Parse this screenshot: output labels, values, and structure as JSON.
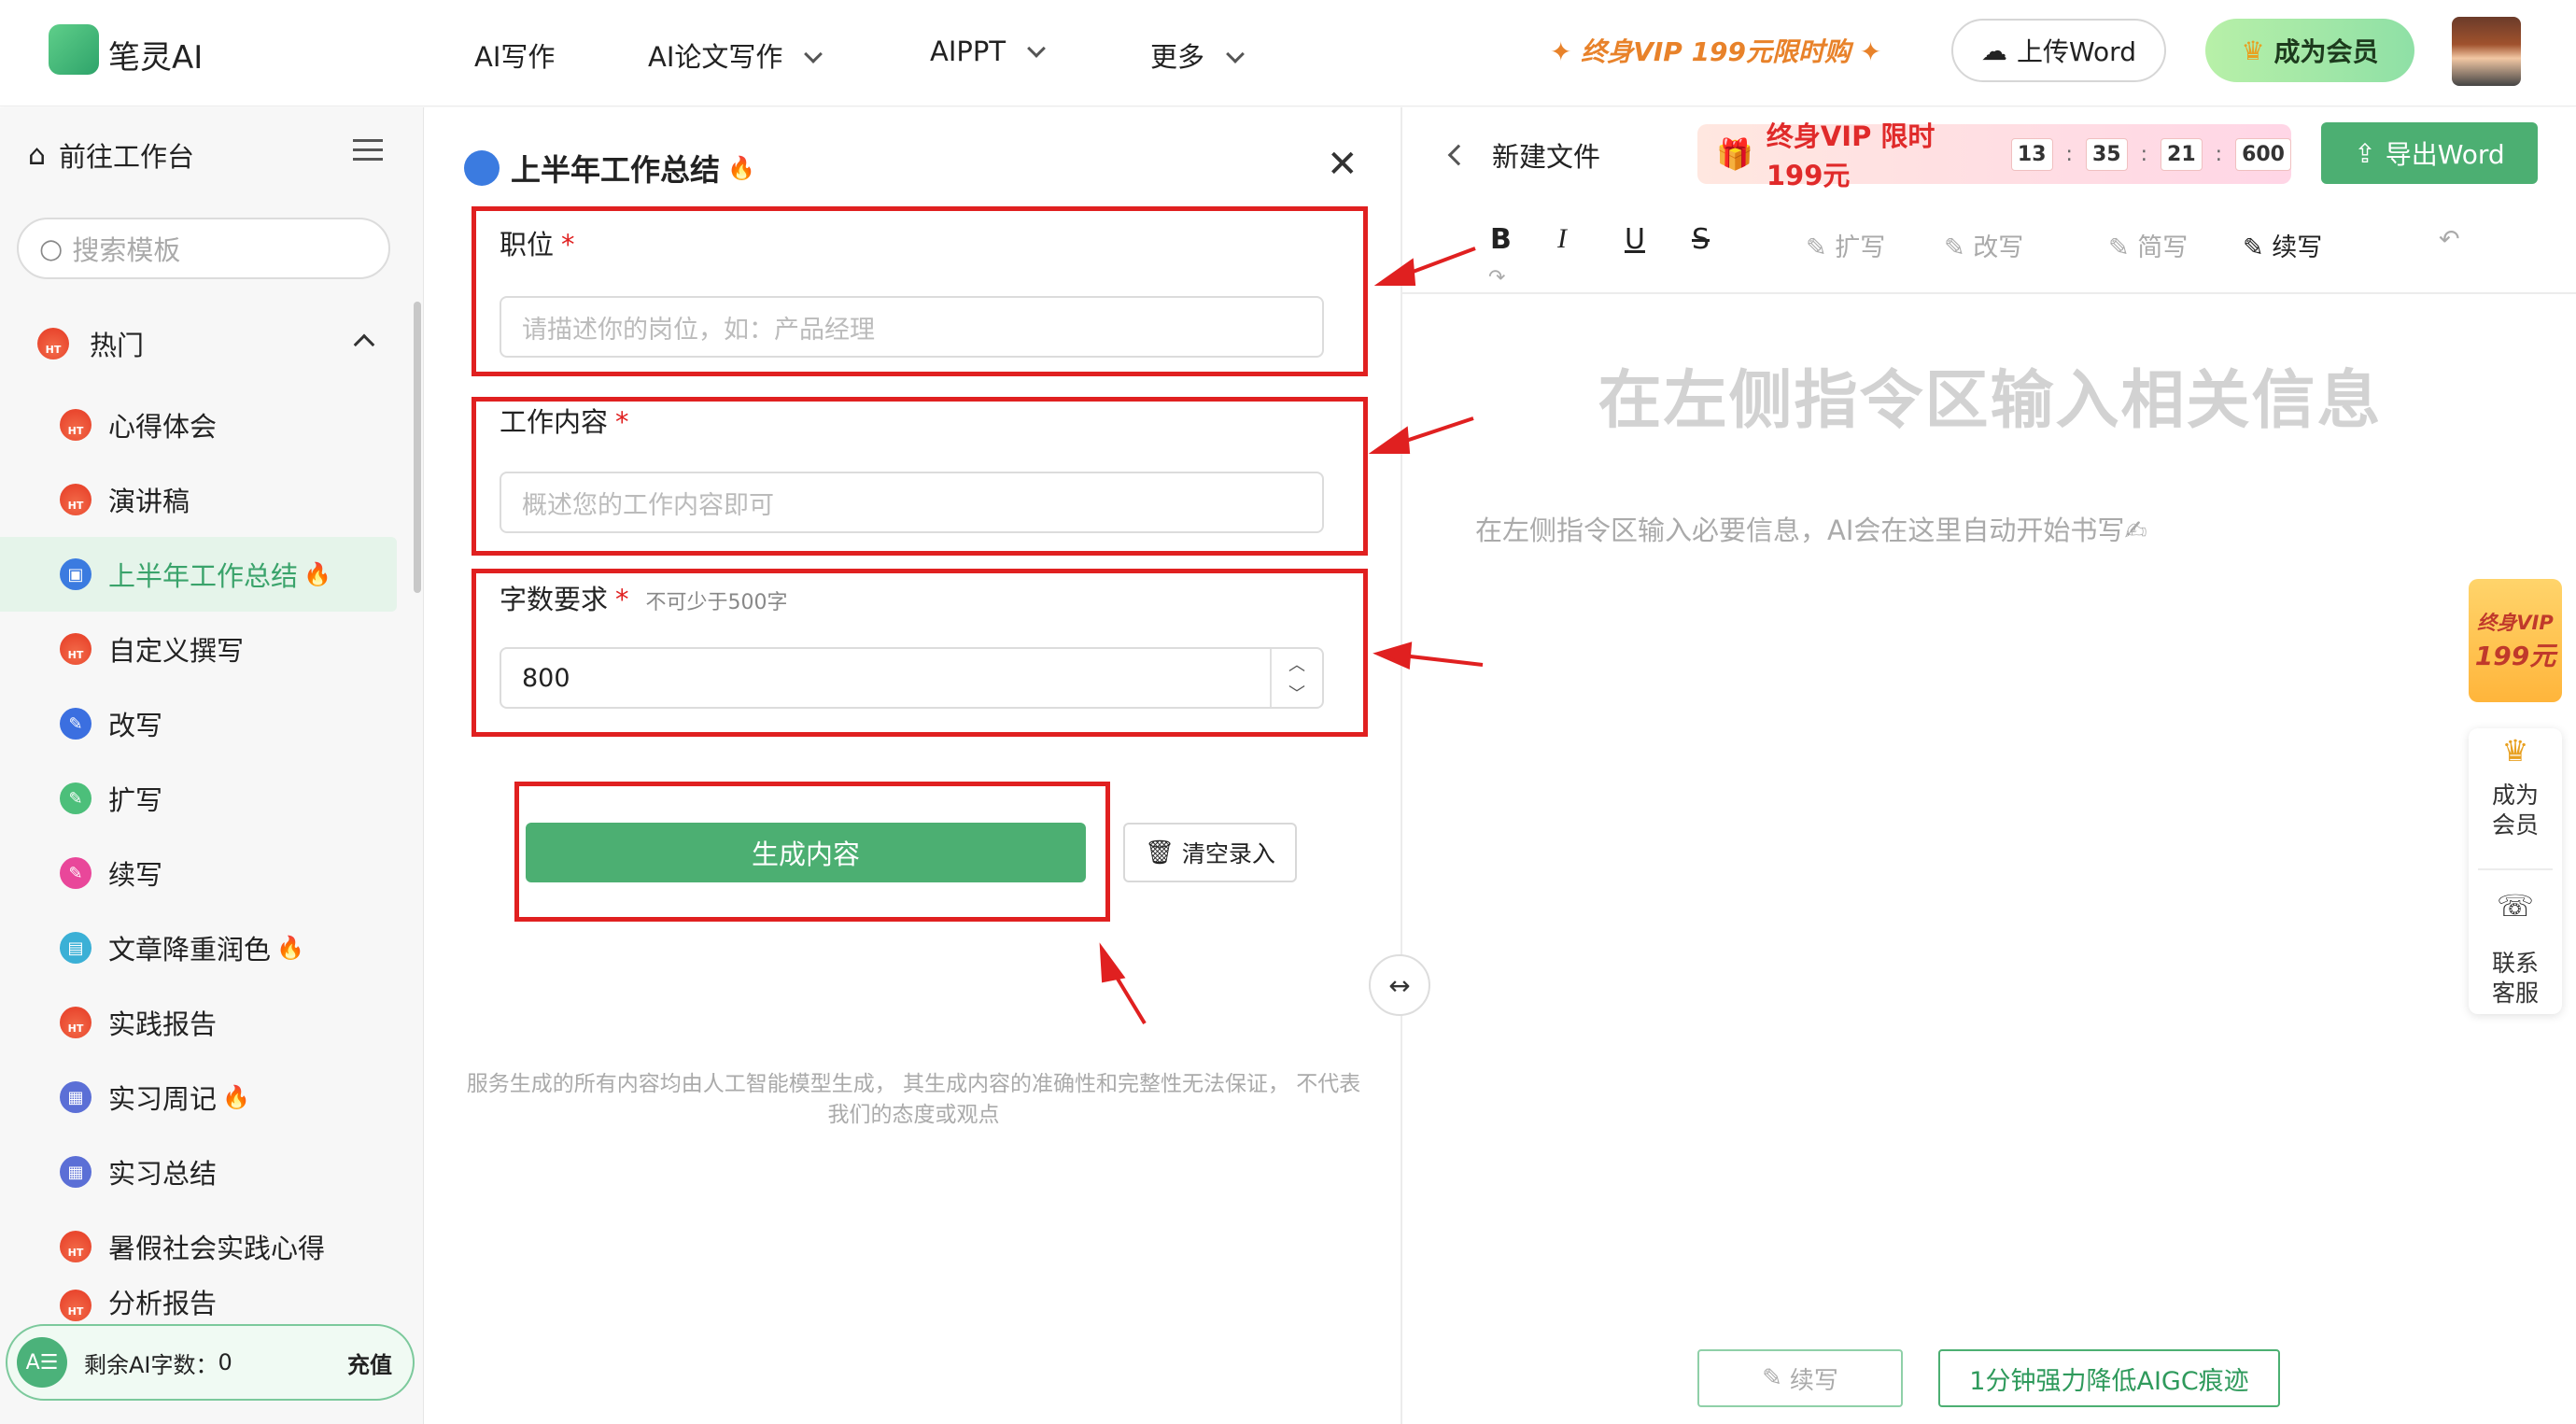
{
  "header": {
    "app_name": "笔灵AI",
    "nav": [
      "AI写作",
      "AI论文写作",
      "AIPPT",
      "更多"
    ],
    "vip_promo": "终身VIP 199元限时购",
    "upload_label": "上传Word",
    "member_label": "成为会员"
  },
  "sidebar": {
    "workspace_label": "前往工作台",
    "search_placeholder": "搜索模板",
    "group_label": "热门",
    "items": [
      {
        "label": "心得体会",
        "icon": "ht"
      },
      {
        "label": "演讲稿",
        "icon": "ht"
      },
      {
        "label": "上半年工作总结",
        "icon": "briefcase",
        "active": true,
        "hot": true
      },
      {
        "label": "自定义撰写",
        "icon": "ht"
      },
      {
        "label": "改写",
        "icon": "rewrite"
      },
      {
        "label": "扩写",
        "icon": "expand"
      },
      {
        "label": "续写",
        "icon": "continue"
      },
      {
        "label": "文章降重润色",
        "icon": "polish",
        "hot": true
      },
      {
        "label": "实践报告",
        "icon": "ht"
      },
      {
        "label": "实习周记",
        "icon": "journal",
        "hot": true
      },
      {
        "label": "实习总结",
        "icon": "journal"
      },
      {
        "label": "暑假社会实践心得",
        "icon": "ht"
      },
      {
        "label": "分析报告",
        "icon": "ht"
      }
    ],
    "remaining_label": "剩余AI字数：",
    "remaining_value": "0",
    "recharge_label": "充值",
    "ai_badge": "A☰"
  },
  "form": {
    "title": "上半年工作总结",
    "position_label": "职位",
    "position_placeholder": "请描述你的岗位，如：产品经理",
    "content_label": "工作内容",
    "content_placeholder": "概述您的工作内容即可",
    "words_label": "字数要求",
    "words_hint": "不可少于500字",
    "words_value": "800",
    "generate_label": "生成内容",
    "clear_label": "清空录入",
    "disclaimer": "服务生成的所有内容均由人工智能模型生成， 其生成内容的准确性和完整性无法保证， 不代表我们的态度或观点"
  },
  "editor": {
    "file_label": "新建文件",
    "promo_text": "终身VIP 限时 199元",
    "countdown": [
      "13",
      "35",
      "21",
      "600"
    ],
    "export_label": "导出Word",
    "toolbar": {
      "bold": "B",
      "italic": "I",
      "underline": "U",
      "strike": "S",
      "expand": "扩写",
      "rewrite": "改写",
      "simplify": "简写",
      "continue": "续写"
    },
    "heading": "在左侧指令区输入相关信息",
    "paragraph": "在左侧指令区输入必要信息，AI会在这里自动开始书写✍",
    "bottom_continue": "续写",
    "bottom_aigc": "1分钟强力降低AIGC痕迹"
  },
  "float": {
    "vip_line1": "终身VIP",
    "vip_line2": "199元",
    "member_line": "成为\n会员",
    "support_line": "联系\n客服"
  },
  "colors": {
    "brand_green": "#4caf72",
    "annotation_red": "#e02020",
    "active_bg": "#e5f4ea"
  }
}
